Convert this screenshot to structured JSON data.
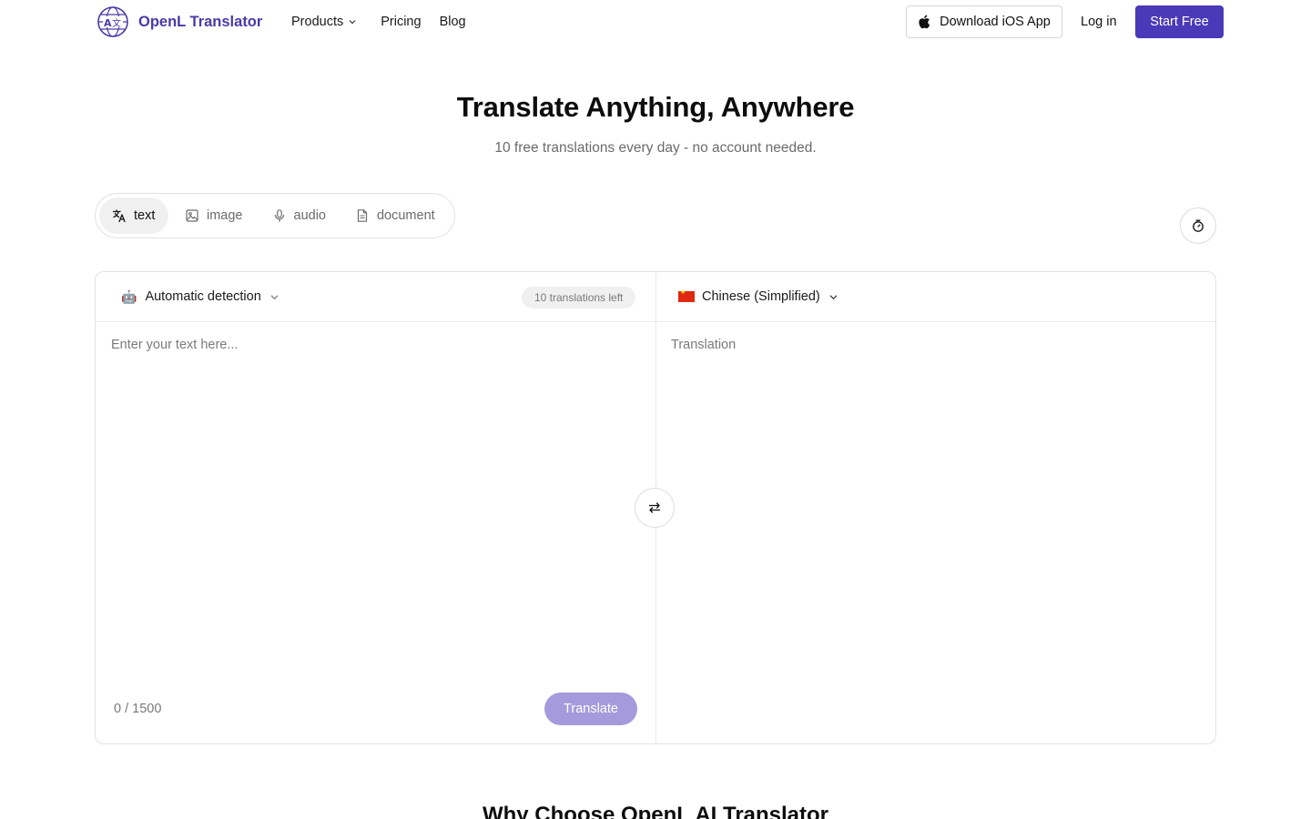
{
  "header": {
    "brand": "OpenL Translator",
    "logo_icon": "globe-translate-icon",
    "nav": {
      "products": "Products",
      "pricing": "Pricing",
      "blog": "Blog"
    },
    "ios_button": "Download iOS App",
    "login": "Log in",
    "start_free": "Start Free"
  },
  "hero": {
    "title": "Translate Anything, Anywhere",
    "subtitle": "10 free translations every day - no account needed."
  },
  "modes": [
    {
      "label": "text",
      "icon": "translate-icon",
      "active": true
    },
    {
      "label": "image",
      "icon": "image-icon",
      "active": false
    },
    {
      "label": "audio",
      "icon": "microphone-icon",
      "active": false
    },
    {
      "label": "document",
      "icon": "document-icon",
      "active": false
    }
  ],
  "translator": {
    "source_language": "Automatic detection",
    "source_emoji": "🤖",
    "quota": "10 translations left",
    "target_language": "Chinese (Simplified)",
    "target_flag": "flag-china-icon",
    "input_placeholder": "Enter your text here...",
    "output_placeholder": "Translation",
    "char_count": "0 / 1500",
    "translate_button": "Translate"
  },
  "section_heading": "Why Choose OpenL AI Translator",
  "colors": {
    "brand": "#4a3ab8",
    "translate_disabled": "#a59bdc"
  }
}
